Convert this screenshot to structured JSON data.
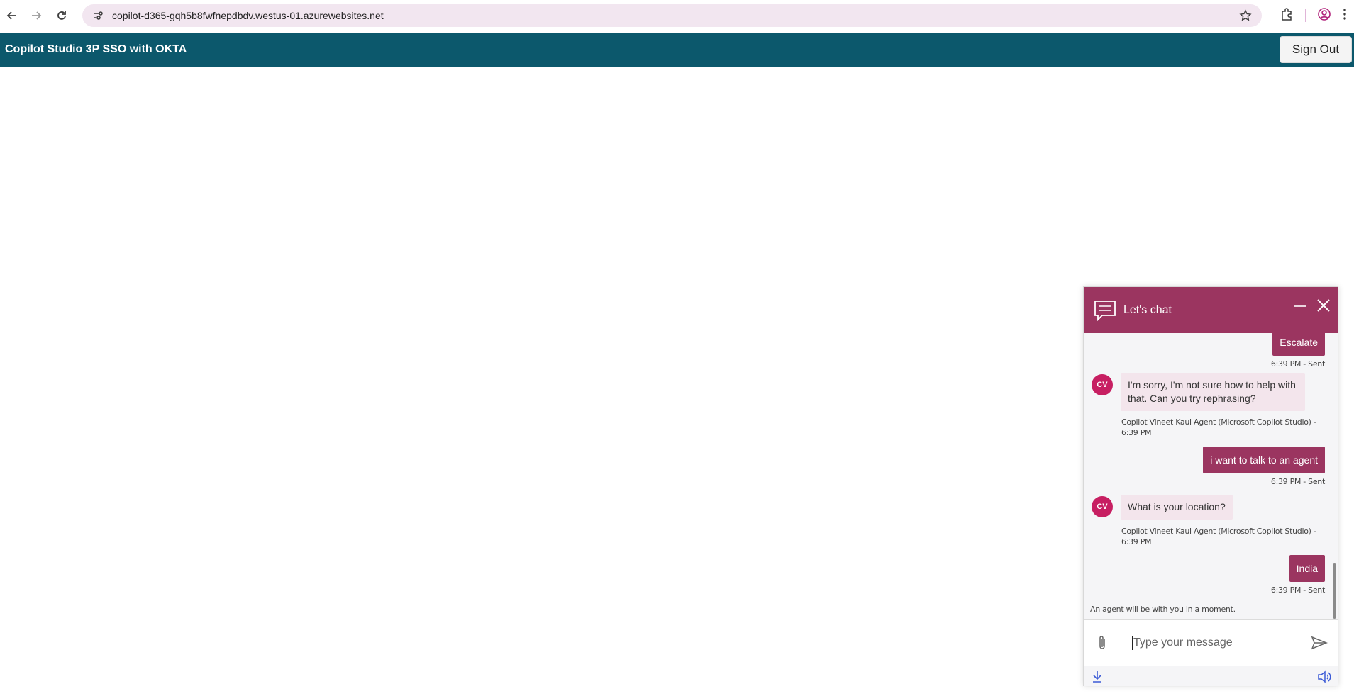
{
  "browser": {
    "url": "copilot-d365-gqh5b8fwfnepdbdv.westus-01.azurewebsites.net",
    "icons": [
      "back-icon",
      "forward-icon",
      "reload-icon",
      "site-info-icon",
      "bookmark-star-icon",
      "extensions-icon",
      "profile-icon",
      "menu-icon"
    ]
  },
  "header": {
    "title": "Copilot Studio 3P SSO with OKTA",
    "signout_label": "Sign Out",
    "background": "#0c586c"
  },
  "chat": {
    "title": "Let's chat",
    "accent": "#9b3560",
    "avatar_initials": "CV",
    "messages": [
      {
        "from": "user",
        "text": "Escalate",
        "meta": "6:39 PM - Sent"
      },
      {
        "from": "bot",
        "text": "I'm sorry, I'm not sure how to help with that. Can you try rephrasing?",
        "meta": "Copilot Vineet Kaul Agent (Microsoft Copilot Studio) - 6:39 PM"
      },
      {
        "from": "user",
        "text": "i want to talk to an agent",
        "meta": "6:39 PM - Sent"
      },
      {
        "from": "bot",
        "text": "What is your location?",
        "meta": "Copilot Vineet Kaul Agent (Microsoft Copilot Studio) - 6:39 PM"
      },
      {
        "from": "user",
        "text": "India",
        "meta": "6:39 PM - Sent"
      }
    ],
    "system_message": "An agent will be with you in a moment.",
    "input_placeholder": "Type your message"
  }
}
